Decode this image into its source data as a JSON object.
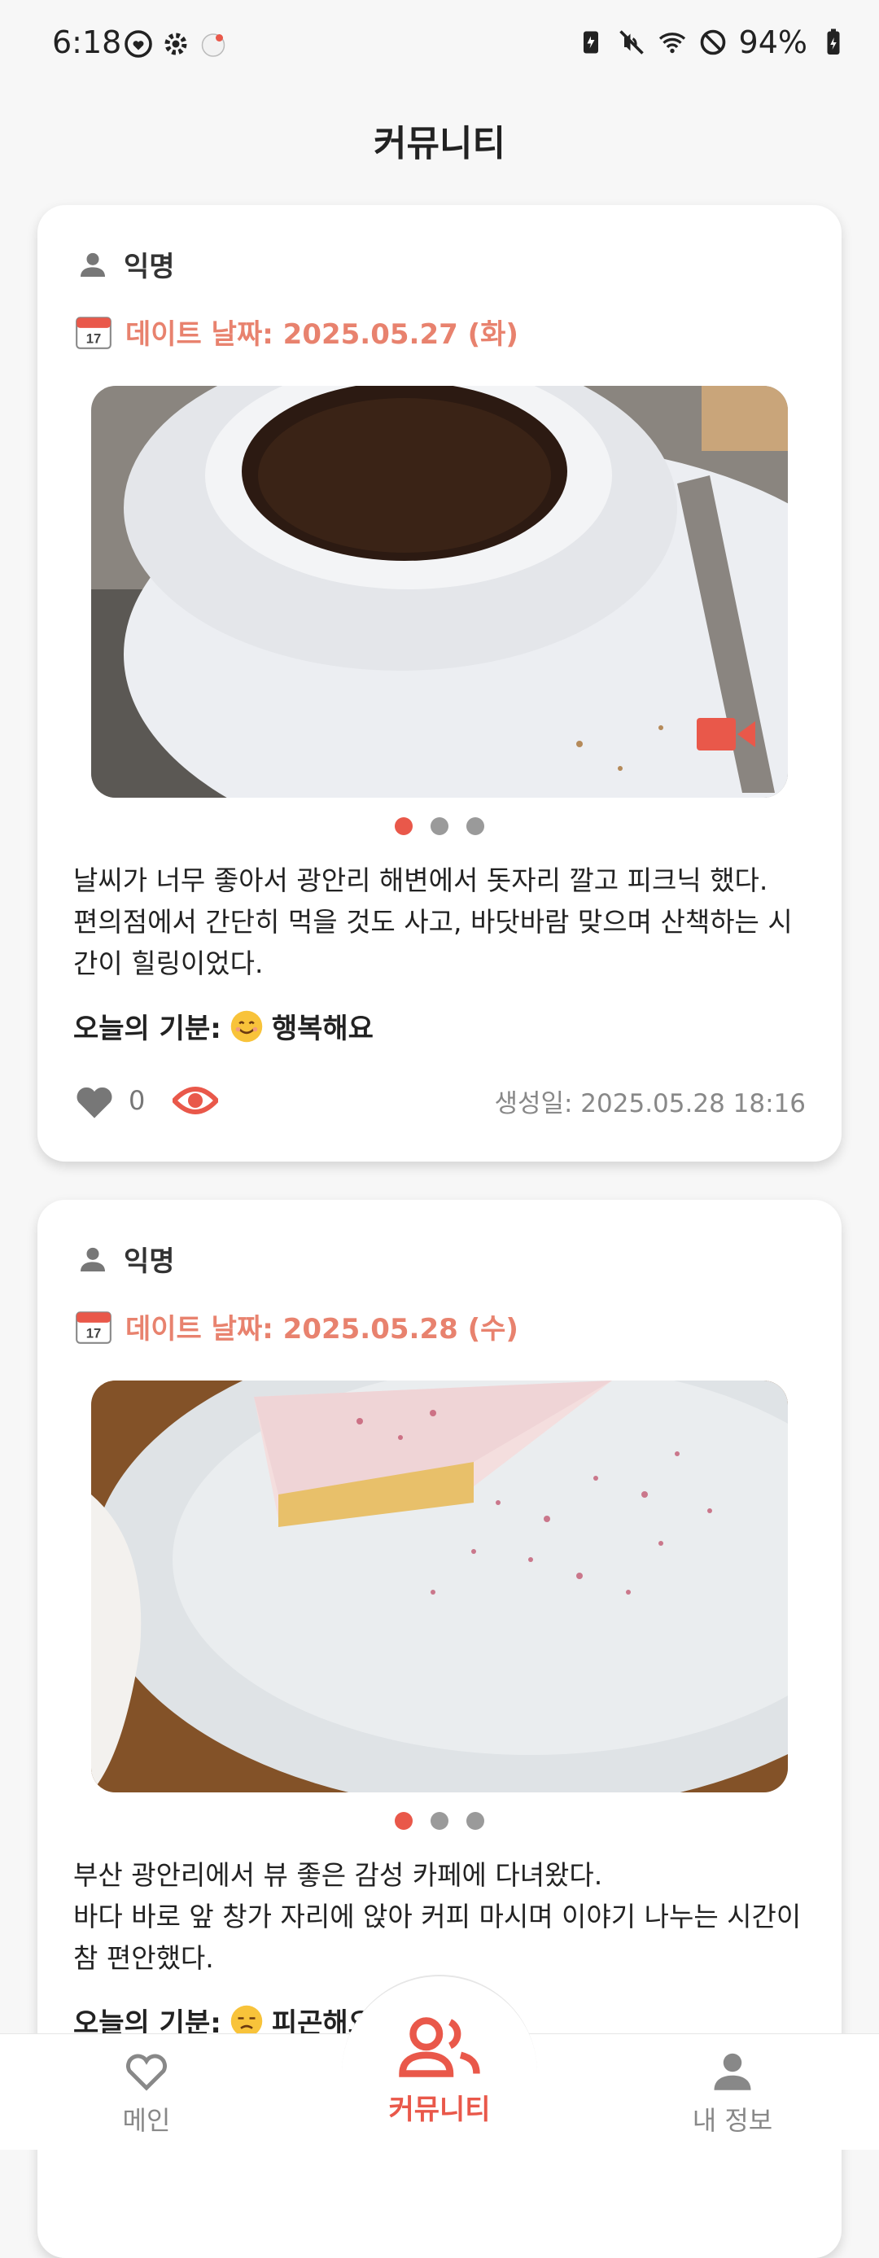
{
  "status_bar": {
    "time": "6:18",
    "battery": "94%",
    "icons": [
      "heart-circle-icon",
      "gear-icon",
      "app-notification-icon",
      "battery-saver-icon",
      "mute-icon",
      "wifi-icon",
      "do-not-disturb-icon",
      "battery-charging-icon"
    ]
  },
  "page": {
    "title": "커뮤니티"
  },
  "posts": [
    {
      "author": "익명",
      "date": "데이트 날짜: 2025.05.27 (화)",
      "text": "날씨가 너무 좋아서 광안리 해변에서 돗자리 깔고 피크닉 했다.\n편의점에서 간단히 먹을 것도 사고, 바닷바람 맞으며 산책하는 시간이 힐링이었다.",
      "mood_label": "오늘의 기분:",
      "mood_value": "행복해요",
      "likes": "0",
      "created": "생성일: 2025.05.28 18:16",
      "media_icon": "video-camera-icon",
      "slide_index": 0,
      "slide_count": 3
    },
    {
      "author": "익명",
      "date": "데이트 날짜: 2025.05.28 (수)",
      "text": "부산 광안리에서 뷰 좋은 감성 카페에 다녀왔다.\n바다 바로 앞 창가 자리에 앉아 커피 마시며 이야기 나누는 시간이 참 편안했다.",
      "mood_label": "오늘의 기분:",
      "mood_value": "피곤해요",
      "slide_index": 0,
      "slide_count": 3
    }
  ],
  "nav": {
    "items": [
      {
        "label": "메인",
        "icon": "heart-icon"
      },
      {
        "label": "커뮤니티",
        "icon": "people-icon",
        "active": true
      },
      {
        "label": "내 정보",
        "icon": "person-icon"
      }
    ]
  },
  "colors": {
    "accent": "#e9584a",
    "date": "#e8826e"
  }
}
